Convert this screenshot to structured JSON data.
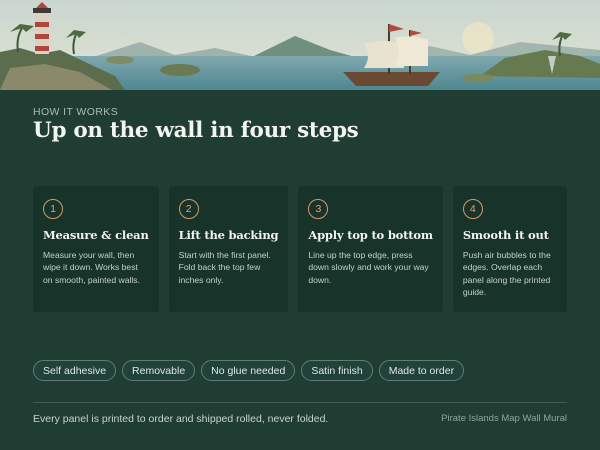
{
  "banner": {
    "image": "tropical-coast-illustration"
  },
  "section": {
    "eyebrow": "HOW IT WORKS",
    "title": "Up on the wall in four steps"
  },
  "steps": [
    {
      "number": "1",
      "title": "Measure & clean",
      "text": "Measure your wall, then wipe it down. Works best on smooth, painted walls."
    },
    {
      "number": "2",
      "title": "Lift the backing",
      "text": "Start with the first panel. Fold back the top few inches only."
    },
    {
      "number": "3",
      "title": "Apply top to bottom",
      "text": "Line up the top edge, press down slowly and work your way down."
    },
    {
      "number": "4",
      "title": "Smooth it out",
      "text": "Push air bubbles to the edges. Overlap each panel along the printed guide."
    }
  ],
  "features": [
    "Self adhesive",
    "Removable",
    "No glue needed",
    "Satin finish",
    "Made to order"
  ],
  "footer": {
    "note": "Every panel is printed to order and shipped rolled, never folded.",
    "product": "Pirate Islands Map Wall Mural"
  },
  "colors": {
    "background": "#1f3d33",
    "card": "#18332a",
    "accent": "#d49a67"
  }
}
